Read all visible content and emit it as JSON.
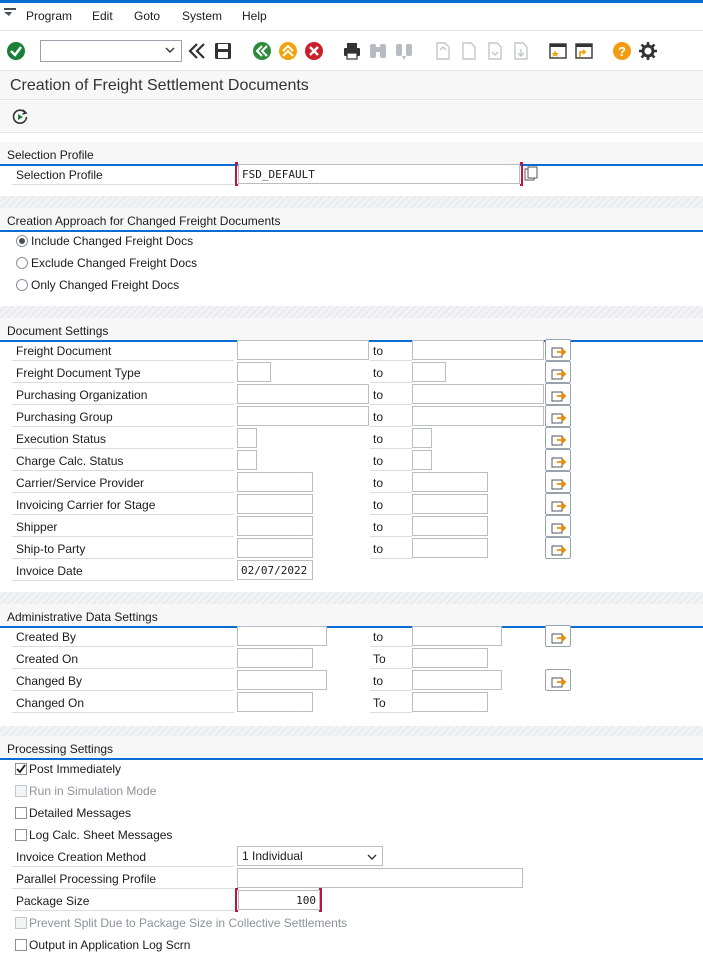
{
  "menubar": {
    "items": [
      "Program",
      "Edit",
      "Goto",
      "System",
      "Help"
    ]
  },
  "toolbar": {
    "command_field_value": "",
    "icons": [
      "enter-icon",
      "command-field",
      "back-double-icon",
      "save-icon",
      "back-icon",
      "exit-icon",
      "cancel-icon",
      "print-icon",
      "find-icon",
      "find-next-icon",
      "first-page-icon",
      "previous-page-icon",
      "next-page-icon",
      "last-page-icon",
      "new-session-icon",
      "shortcut-icon",
      "help-icon",
      "settings-icon"
    ]
  },
  "title": "Creation of Freight Settlement Documents",
  "execute_icon": "execute-icon",
  "sections": {
    "selection_profile": {
      "header": "Selection Profile",
      "label": "Selection Profile",
      "value": "FSD_DEFAULT"
    },
    "creation_approach": {
      "header": "Creation Approach for Changed Freight Documents",
      "options": [
        {
          "label": "Include Changed Freight Docs",
          "selected": true
        },
        {
          "label": "Exclude Changed Freight Docs",
          "selected": false
        },
        {
          "label": "Only Changed Freight Docs",
          "selected": false
        }
      ]
    },
    "document_settings": {
      "header": "Document Settings",
      "to_label": "to",
      "rows": [
        {
          "label": "Freight Document",
          "from": "",
          "to": ""
        },
        {
          "label": "Freight Document Type",
          "from": "",
          "to": ""
        },
        {
          "label": "Purchasing Organization",
          "from": "",
          "to": ""
        },
        {
          "label": "Purchasing Group",
          "from": "",
          "to": ""
        },
        {
          "label": "Execution Status",
          "from": "",
          "to": ""
        },
        {
          "label": "Charge Calc. Status",
          "from": "",
          "to": ""
        },
        {
          "label": "Carrier/Service Provider",
          "from": "",
          "to": ""
        },
        {
          "label": "Invoicing Carrier for Stage",
          "from": "",
          "to": ""
        },
        {
          "label": "Shipper",
          "from": "",
          "to": ""
        },
        {
          "label": "Ship-to Party",
          "from": "",
          "to": ""
        }
      ],
      "invoice_date_label": "Invoice Date",
      "invoice_date_value": "02/07/2022"
    },
    "admin_settings": {
      "header": "Administrative Data Settings",
      "rows": [
        {
          "label": "Created By",
          "to_label": "to",
          "from": "",
          "to": ""
        },
        {
          "label": "Created On",
          "to_label": "To",
          "from": "",
          "to": ""
        },
        {
          "label": "Changed By",
          "to_label": "to",
          "from": "",
          "to": ""
        },
        {
          "label": "Changed On",
          "to_label": "To",
          "from": "",
          "to": ""
        }
      ]
    },
    "processing_settings": {
      "header": "Processing Settings",
      "checkboxes": [
        {
          "label": "Post Immediately",
          "checked": true,
          "enabled": true
        },
        {
          "label": "Run in Simulation Mode",
          "checked": false,
          "enabled": false
        },
        {
          "label": "Detailed Messages",
          "checked": false,
          "enabled": true
        },
        {
          "label": "Log Calc. Sheet Messages",
          "checked": false,
          "enabled": true
        }
      ],
      "invoice_method_label": "Invoice Creation Method",
      "invoice_method_value": "1 Individual",
      "parallel_profile_label": "Parallel Processing Profile",
      "parallel_profile_value": "",
      "package_size_label": "Package Size",
      "package_size_value": "100",
      "prevent_split_label": "Prevent Split Due to Package Size in Collective Settlements",
      "output_log_label": "Output in Application Log Scrn"
    }
  },
  "colors": {
    "accent": "#0a6ed1",
    "enter_green": "#1a7f37",
    "back_green": "#2e8b3d",
    "exit_orange": "#f0a30a",
    "cancel_red": "#cc1f2c",
    "help_orange": "#f39c12",
    "required_red": "#c0143c"
  }
}
